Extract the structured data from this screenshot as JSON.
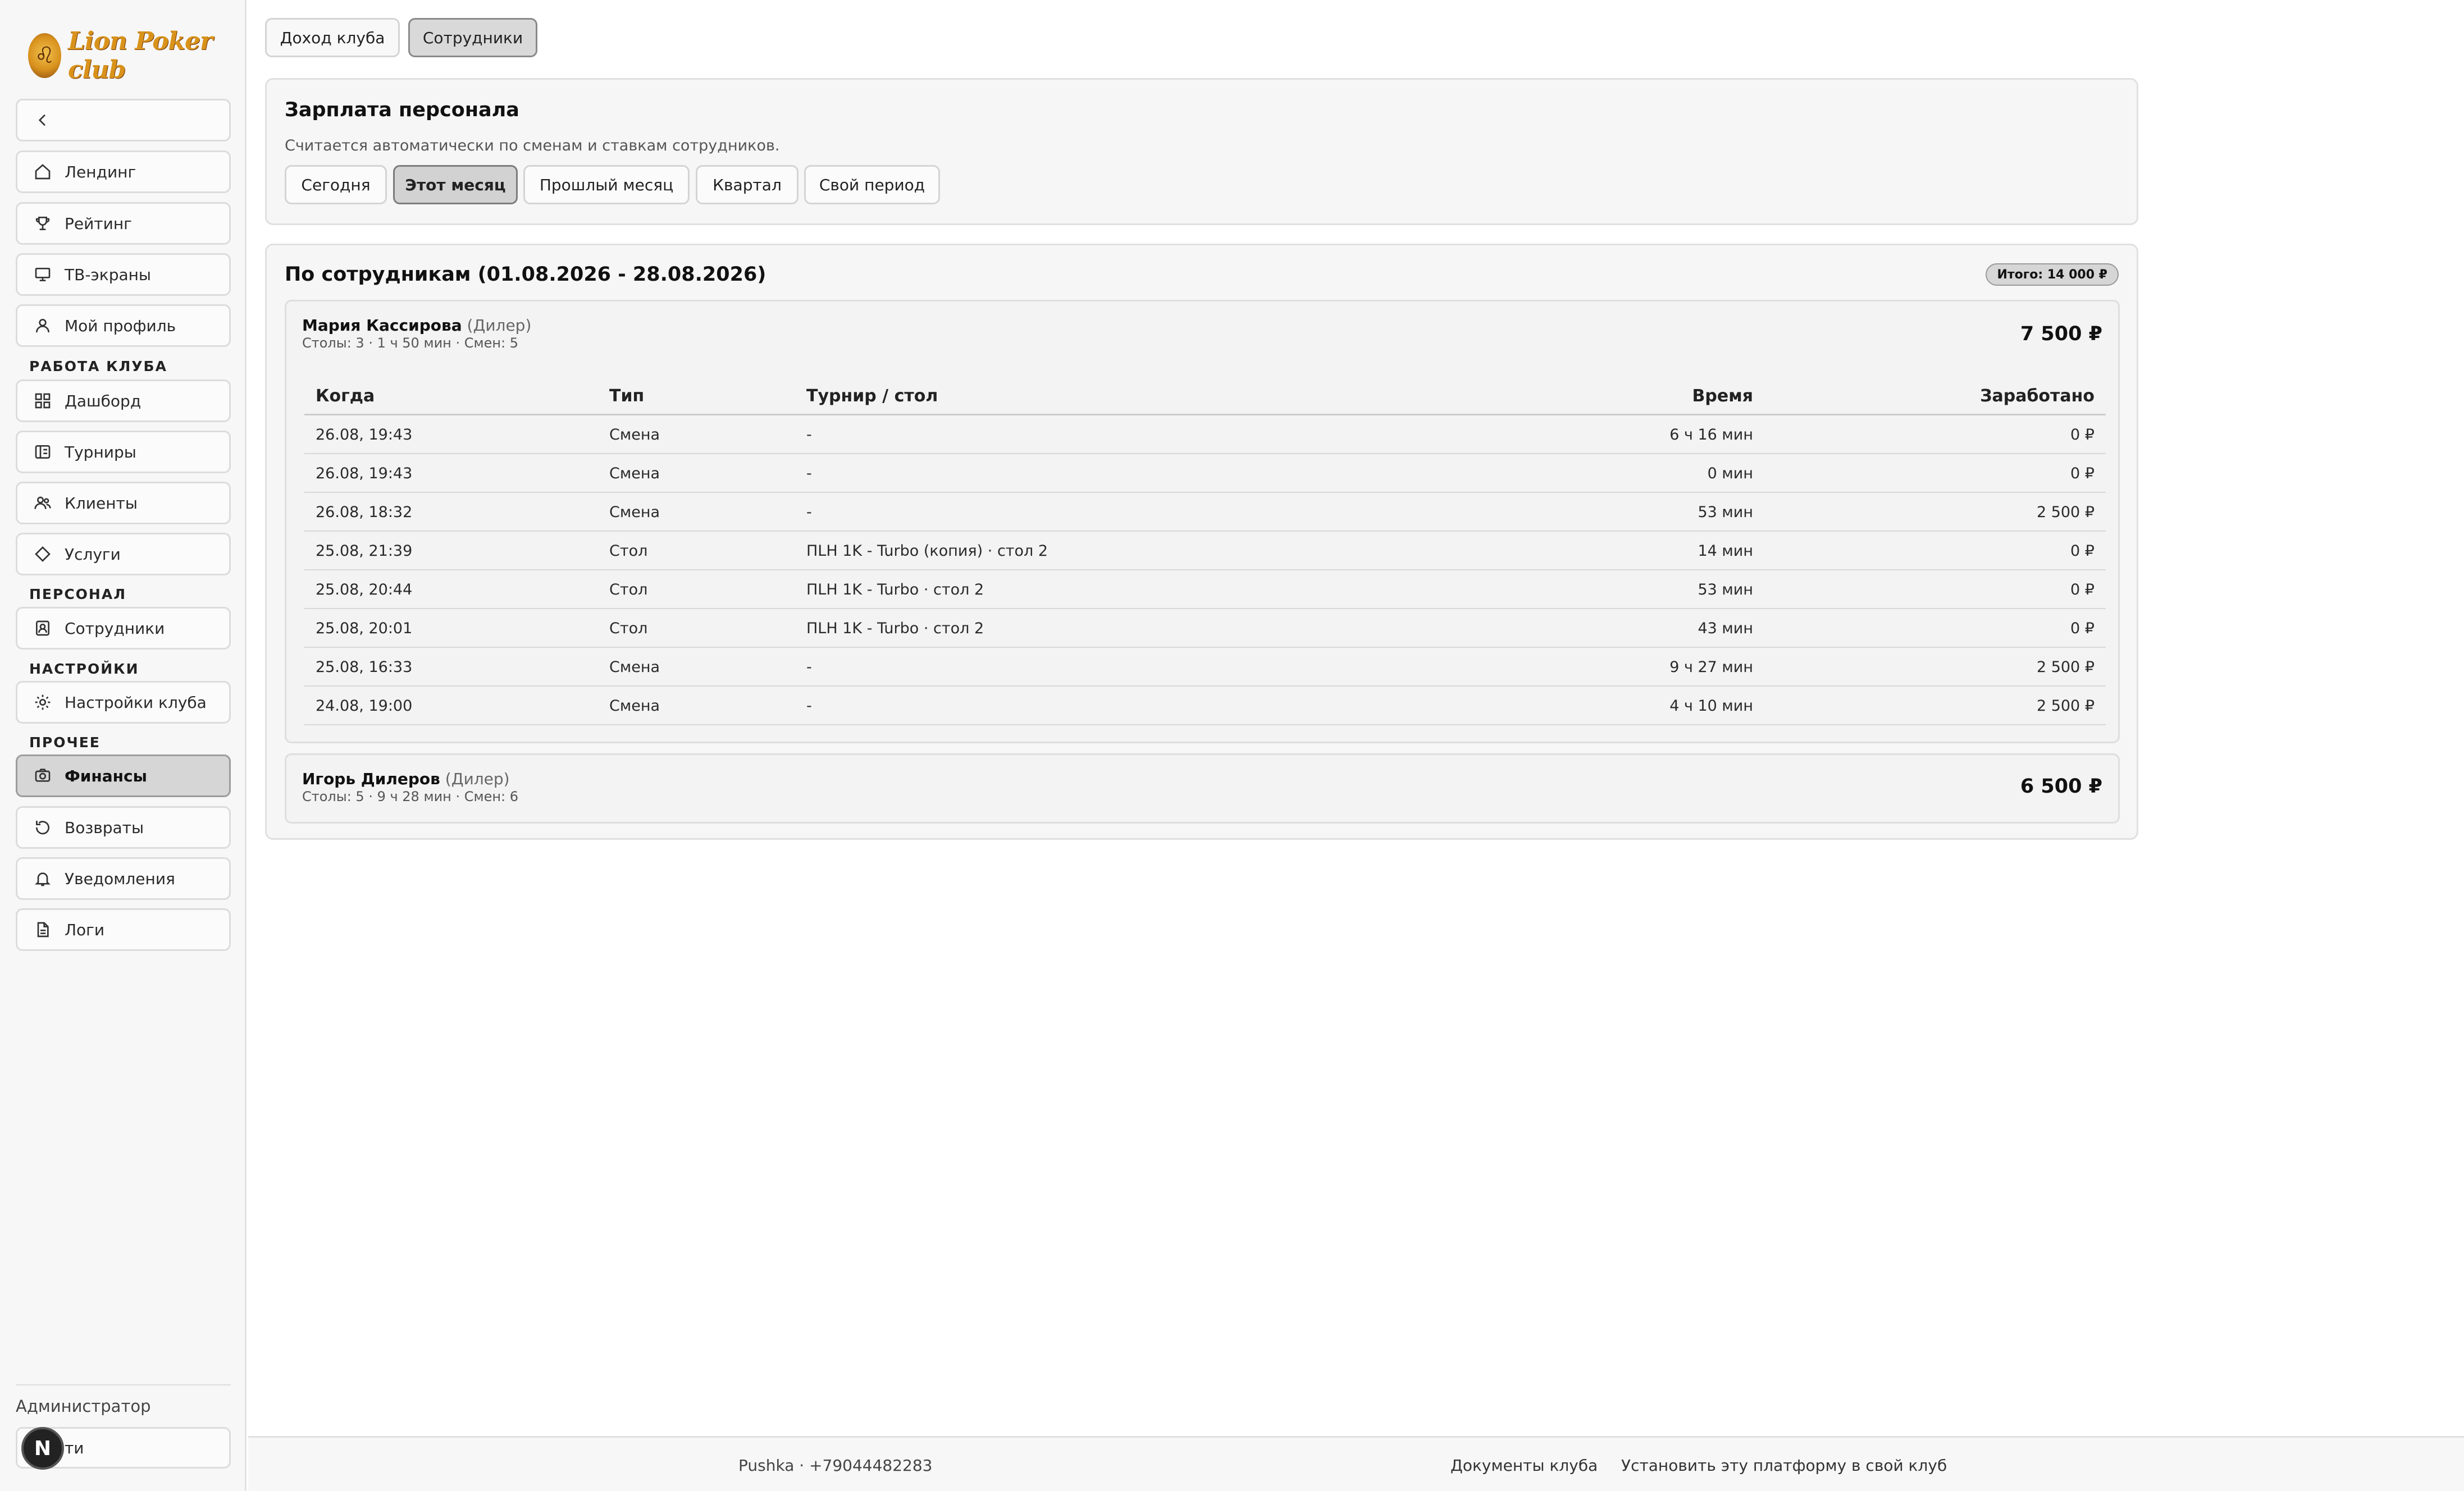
{
  "sidebar": {
    "logo_text": "Lion Poker club",
    "back_icon": "chevron-left-icon",
    "items_top": [
      {
        "label": "Лендинг",
        "icon": "home-icon"
      },
      {
        "label": "Рейтинг",
        "icon": "trophy-icon"
      },
      {
        "label": "ТВ-экраны",
        "icon": "monitor-icon"
      },
      {
        "label": "Мой профиль",
        "icon": "user-icon"
      }
    ],
    "section_club": "РАБОТА КЛУБА",
    "items_club": [
      {
        "label": "Дашборд",
        "icon": "grid-icon"
      },
      {
        "label": "Турниры",
        "icon": "tournament-icon"
      },
      {
        "label": "Клиенты",
        "icon": "users-icon"
      },
      {
        "label": "Услуги",
        "icon": "diamond-icon"
      }
    ],
    "section_staff": "ПЕРСОНАЛ",
    "items_staff": [
      {
        "label": "Сотрудники",
        "icon": "badge-icon"
      }
    ],
    "section_settings": "НАСТРОЙКИ",
    "items_settings": [
      {
        "label": "Настройки клуба",
        "icon": "gear-icon"
      }
    ],
    "section_other": "ПРОЧЕЕ",
    "items_other": [
      {
        "label": "Финансы",
        "icon": "camera-icon",
        "active": true
      },
      {
        "label": "Возвраты",
        "icon": "refresh-icon"
      },
      {
        "label": "Уведомления",
        "icon": "bell-icon"
      },
      {
        "label": "Логи",
        "icon": "document-icon"
      }
    ],
    "role": "Администратор",
    "logout_label": "ти",
    "avatar_letter": "N"
  },
  "tabs": [
    {
      "label": "Доход клуба",
      "active": false
    },
    {
      "label": "Сотрудники",
      "active": true
    }
  ],
  "salary_card": {
    "title": "Зарплата персонала",
    "subtitle": "Считается автоматически по сменам и ставкам сотрудников.",
    "periods": [
      {
        "label": "Сегодня",
        "active": false
      },
      {
        "label": "Этот месяц",
        "active": true
      },
      {
        "label": "Прошлый месяц",
        "active": false
      },
      {
        "label": "Квартал",
        "active": false
      },
      {
        "label": "Свой период",
        "active": false
      }
    ]
  },
  "by_staff": {
    "title": "По сотрудникам (01.08.2026 - 28.08.2026)",
    "total": "Итого: 14 000 ₽",
    "columns": {
      "when": "Когда",
      "type": "Тип",
      "tournament": "Турнир / стол",
      "time": "Время",
      "earned": "Заработано"
    },
    "employees": [
      {
        "name": "Мария Кассирова",
        "role": "(Дилер)",
        "meta": "Столы: 3 · 1 ч 50 мин · Смен: 5",
        "amount": "7 500 ₽",
        "rows": [
          {
            "when": "26.08, 19:43",
            "type": "Смена",
            "tournament": "-",
            "time": "6 ч 16 мин",
            "earned": "0 ₽"
          },
          {
            "when": "26.08, 19:43",
            "type": "Смена",
            "tournament": "-",
            "time": "0 мин",
            "earned": "0 ₽"
          },
          {
            "when": "26.08, 18:32",
            "type": "Смена",
            "tournament": "-",
            "time": "53 мин",
            "earned": "2 500 ₽"
          },
          {
            "when": "25.08, 21:39",
            "type": "Стол",
            "tournament": "ПLH 1K - Turbo (копия) · стол 2",
            "time": "14 мин",
            "earned": "0 ₽"
          },
          {
            "when": "25.08, 20:44",
            "type": "Стол",
            "tournament": "ПLH 1K - Turbo · стол 2",
            "time": "53 мин",
            "earned": "0 ₽"
          },
          {
            "when": "25.08, 20:01",
            "type": "Стол",
            "tournament": "ПLH 1K - Turbo · стол 2",
            "time": "43 мин",
            "earned": "0 ₽"
          },
          {
            "when": "25.08, 16:33",
            "type": "Смена",
            "tournament": "-",
            "time": "9 ч 27 мин",
            "earned": "2 500 ₽"
          },
          {
            "when": "24.08, 19:00",
            "type": "Смена",
            "tournament": "-",
            "time": "4 ч 10 мин",
            "earned": "2 500 ₽"
          }
        ]
      },
      {
        "name": "Игорь Дилеров",
        "role": "(Дилер)",
        "meta": "Столы: 5 · 9 ч 28 мин · Смен: 6",
        "amount": "6 500 ₽"
      }
    ]
  },
  "footer": {
    "contact": "Pushka · +79044482283",
    "docs_link": "Документы клуба",
    "install_link": "Установить эту платформу в свой клуб"
  }
}
